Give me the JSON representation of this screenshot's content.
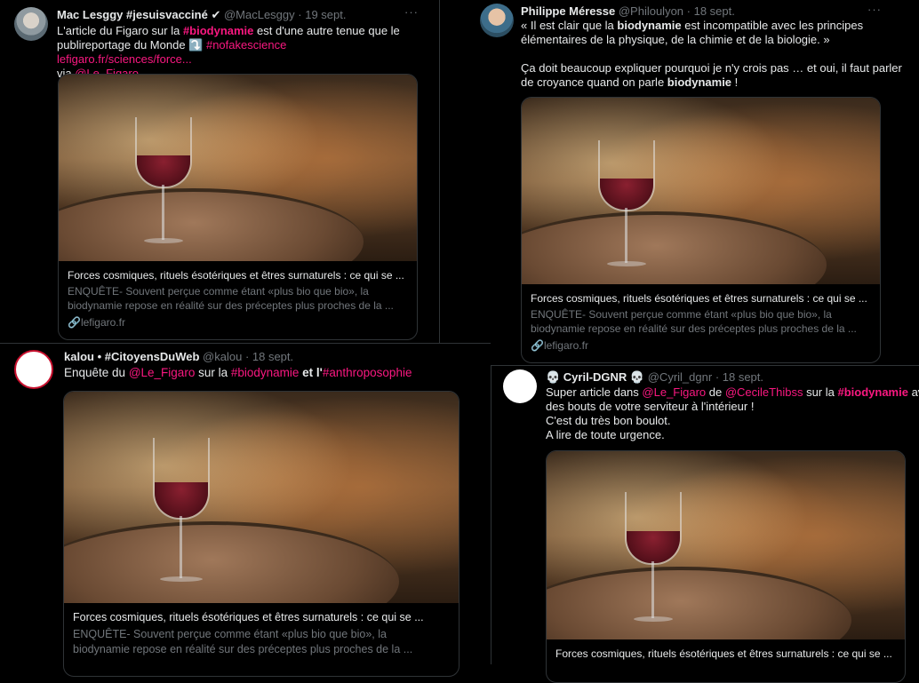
{
  "card": {
    "title": "Forces cosmiques, rituels ésotériques et êtres surnaturels : ce qui se ...",
    "desc_line1": "ENQUÊTE- Souvent perçue comme étant «plus bio que bio», la",
    "desc_line2": "biodynamie repose en réalité sur des préceptes plus proches de la ...",
    "domain": "lefigaro.fr"
  },
  "tweets": [
    {
      "name": "Mac Lesggy #jesuisvacciné",
      "handle": "@MacLesggy",
      "date": "· 19 sept.",
      "more": "···",
      "line1_a": "L'article du Figaro sur la ",
      "line1_tag": "#biodynamie",
      "line1_b": " est d'une autre tenue que le",
      "line2_a": "publireportage du Monde ⤵️ ",
      "line2_tag": "#nofakescience",
      "line2_link": " lefigaro.fr/sciences/force...",
      "line3_a": "via ",
      "line3_mention": "@Le_Figaro"
    },
    {
      "name": "Philippe Méresse",
      "handle": "@Philoulyon",
      "date": "· 18 sept.",
      "more": "···",
      "line1_a": "« Il est clair que la ",
      "line1_bold": "biodynamie",
      "line1_b": " est incompatible avec les principes",
      "line2": "élémentaires de la physique, de la chimie et de la biologie. »",
      "line3": "Ça doit beaucoup expliquer pourquoi je n'y crois pas … et oui, il faut parler",
      "line4_a": "de croyance quand on parle ",
      "line4_bold": "biodynamie",
      "line4_b": " !"
    },
    {
      "name": "kalou • #CitoyensDuWeb",
      "handle": "@kalou",
      "date": "· 18 sept.",
      "line1_a": "Enquête du ",
      "line1_mention": "@Le_Figaro",
      "line1_b": " sur la ",
      "line1_tag": "#biodynamie",
      "line1_c": " et l'",
      "line1_tag2": "#anthroposophie"
    },
    {
      "name": "💀 Cyril-DGNR 💀",
      "handle": "@Cyril_dgnr",
      "date": "· 18 sept.",
      "line1_a": "Super article dans ",
      "line1_m1": "@Le_Figaro",
      "line1_b": " de ",
      "line1_m2": "@CecileThibss",
      "line1_c": "  sur la ",
      "line1_tag": "#biodynamie",
      "line1_d": " avec",
      "line2": "des bouts de votre serviteur à l'intérieur !",
      "line3": "C'est du très bon boulot.",
      "line4": "A lire de toute urgence."
    }
  ],
  "colors": {
    "background": "#000000",
    "text": "#e7e9ea",
    "muted": "#71767b",
    "accent": "#f91880",
    "border": "#2f3336"
  }
}
